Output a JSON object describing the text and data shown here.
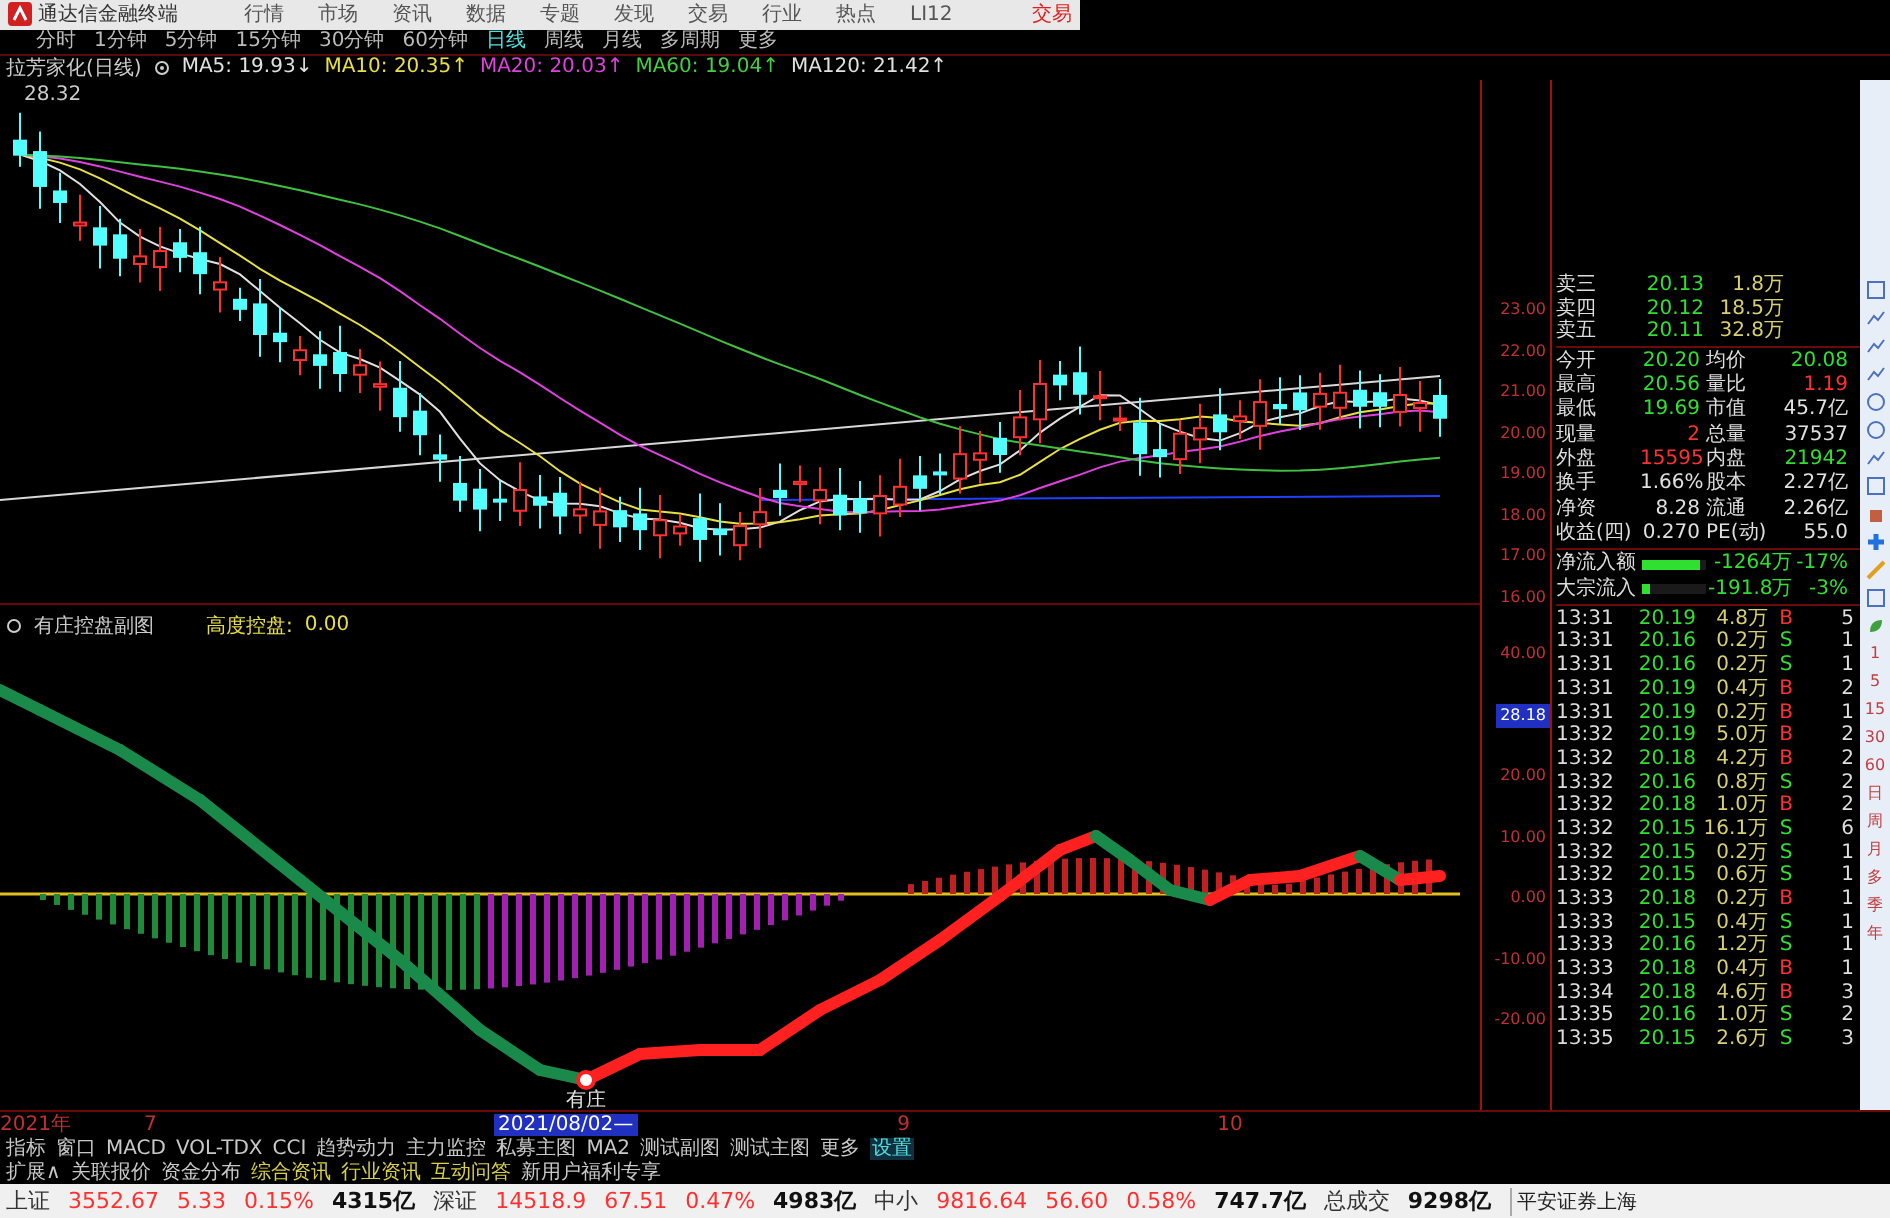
{
  "menu": {
    "app_title": "通达信金融终端",
    "items": [
      "行情",
      "市场",
      "资讯",
      "数据",
      "专题",
      "发现",
      "交易",
      "行业",
      "热点",
      "LI12"
    ],
    "trade_label": "交易"
  },
  "periods": [
    {
      "label": "分时",
      "selected": false
    },
    {
      "label": "1分钟",
      "selected": false
    },
    {
      "label": "5分钟",
      "selected": false
    },
    {
      "label": "15分钟",
      "selected": false
    },
    {
      "label": "30分钟",
      "selected": false
    },
    {
      "label": "60分钟",
      "selected": false
    },
    {
      "label": "日线",
      "selected": true
    },
    {
      "label": "周线",
      "selected": false
    },
    {
      "label": "月线",
      "selected": false
    },
    {
      "label": "多周期",
      "selected": false
    },
    {
      "label": "更多",
      "selected": false
    }
  ],
  "legend": {
    "stock": "拉芳家化(日线)",
    "items": [
      {
        "label": "MA5: 19.93↓",
        "color": "#e0e0e0"
      },
      {
        "label": "MA10: 20.35↑",
        "color": "#e8e040"
      },
      {
        "label": "MA20: 20.03↑",
        "color": "#e040e0"
      },
      {
        "label": "MA60: 19.04↑",
        "color": "#40d040"
      },
      {
        "label": "MA120: 21.42↑",
        "color": "#e0e0e0"
      }
    ]
  },
  "high_marker": "28.32",
  "price_axis": [
    "23.00",
    "22.00",
    "21.00",
    "20.00",
    "19.00",
    "18.00",
    "17.00",
    "16.00"
  ],
  "indicator": {
    "title": "有庄控盘副图",
    "reading_label": "高度控盘:",
    "reading_value": "0.00",
    "annotation": "有庄"
  },
  "indicator_axis": [
    {
      "label": "40.00",
      "highlighted": false
    },
    {
      "label": "28.18",
      "highlighted": true
    },
    {
      "label": "20.00",
      "highlighted": false
    },
    {
      "label": "10.00",
      "highlighted": false
    },
    {
      "label": "0.00",
      "highlighted": false
    },
    {
      "label": "-10.00",
      "highlighted": false
    },
    {
      "label": "-20.00",
      "highlighted": false
    }
  ],
  "order_book": [
    {
      "label": "卖三",
      "price": "20.13",
      "volume": "1.8万"
    },
    {
      "label": "卖四",
      "price": "20.12",
      "volume": "18.5万"
    },
    {
      "label": "卖五",
      "price": "20.11",
      "volume": "32.8万"
    }
  ],
  "stats": [
    {
      "cells": [
        {
          "label": "今开",
          "value": "20.20",
          "color": "#30e030"
        },
        {
          "label": "均价",
          "value": "20.08",
          "color": "#30e030"
        }
      ]
    },
    {
      "cells": [
        {
          "label": "最高",
          "value": "20.56",
          "color": "#30e030"
        },
        {
          "label": "量比",
          "value": "1.19",
          "color": "#ff3030"
        }
      ]
    },
    {
      "cells": [
        {
          "label": "最低",
          "value": "19.69",
          "color": "#30e030"
        },
        {
          "label": "市值",
          "value": "45.7亿",
          "color": "#e0e0e0"
        }
      ]
    },
    {
      "cells": [
        {
          "label": "现量",
          "value": "2",
          "color": "#ff3030"
        },
        {
          "label": "总量",
          "value": "37537",
          "color": "#e0e0e0"
        }
      ]
    },
    {
      "cells": [
        {
          "label": "外盘",
          "value": "15595",
          "color": "#ff3030"
        },
        {
          "label": "内盘",
          "value": "21942",
          "color": "#30e030"
        }
      ]
    },
    {
      "cells": [
        {
          "label": "换手",
          "value": "1.66%",
          "color": "#e0e0e0"
        },
        {
          "label": "股本",
          "value": "2.27亿",
          "color": "#e0e0e0"
        }
      ]
    },
    {
      "cells": [
        {
          "label": "净资",
          "value": "8.28",
          "color": "#e0e0e0"
        },
        {
          "label": "流通",
          "value": "2.26亿",
          "color": "#e0e0e0"
        }
      ]
    },
    {
      "cells": [
        {
          "label": "收益(四)",
          "value": "0.270",
          "color": "#e0e0e0"
        },
        {
          "label": "PE(动)",
          "value": "55.0",
          "color": "#e0e0e0"
        }
      ]
    }
  ],
  "flow": [
    {
      "label": "净流入额",
      "level": 0.9,
      "value": "-1264万",
      "pct": "-17%"
    },
    {
      "label": "大宗流入",
      "level": 0.12,
      "value": "-191.8万",
      "pct": "-3%"
    }
  ],
  "trades": [
    {
      "time": "13:31",
      "price": "20.19",
      "volume": "4.8万",
      "side": "B",
      "kind": "buy",
      "count": "5"
    },
    {
      "time": "13:31",
      "price": "20.16",
      "volume": "0.2万",
      "side": "S",
      "kind": "sell",
      "count": "1"
    },
    {
      "time": "13:31",
      "price": "20.16",
      "volume": "0.2万",
      "side": "S",
      "kind": "sell",
      "count": "1"
    },
    {
      "time": "13:31",
      "price": "20.19",
      "volume": "0.4万",
      "side": "B",
      "kind": "buy",
      "count": "2"
    },
    {
      "time": "13:31",
      "price": "20.19",
      "volume": "0.2万",
      "side": "B",
      "kind": "buy",
      "count": "1"
    },
    {
      "time": "13:32",
      "price": "20.19",
      "volume": "5.0万",
      "side": "B",
      "kind": "buy",
      "count": "2"
    },
    {
      "time": "13:32",
      "price": "20.18",
      "volume": "4.2万",
      "side": "B",
      "kind": "buy",
      "count": "2"
    },
    {
      "time": "13:32",
      "price": "20.16",
      "volume": "0.8万",
      "side": "S",
      "kind": "sell",
      "count": "2"
    },
    {
      "time": "13:32",
      "price": "20.18",
      "volume": "1.0万",
      "side": "B",
      "kind": "buy",
      "count": "2"
    },
    {
      "time": "13:32",
      "price": "20.15",
      "volume": "16.1万",
      "side": "S",
      "kind": "sell",
      "count": "6"
    },
    {
      "time": "13:32",
      "price": "20.15",
      "volume": "0.2万",
      "side": "S",
      "kind": "sell",
      "count": "1"
    },
    {
      "time": "13:32",
      "price": "20.15",
      "volume": "0.6万",
      "side": "S",
      "kind": "sell",
      "count": "1"
    },
    {
      "time": "13:33",
      "price": "20.18",
      "volume": "0.2万",
      "side": "B",
      "kind": "buy",
      "count": "1"
    },
    {
      "time": "13:33",
      "price": "20.15",
      "volume": "0.4万",
      "side": "S",
      "kind": "sell",
      "count": "1"
    },
    {
      "time": "13:33",
      "price": "20.16",
      "volume": "1.2万",
      "side": "S",
      "kind": "sell",
      "count": "1"
    },
    {
      "time": "13:33",
      "price": "20.18",
      "volume": "0.4万",
      "side": "B",
      "kind": "buy",
      "count": "1"
    },
    {
      "time": "13:34",
      "price": "20.18",
      "volume": "4.6万",
      "side": "B",
      "kind": "buy",
      "count": "3"
    },
    {
      "time": "13:35",
      "price": "20.16",
      "volume": "1.0万",
      "side": "S",
      "kind": "sell",
      "count": "2"
    },
    {
      "time": "13:35",
      "price": "20.15",
      "volume": "2.6万",
      "side": "S",
      "kind": "sell",
      "count": "3"
    }
  ],
  "side_periods": [
    "1",
    "5",
    "15",
    "30",
    "60",
    "日",
    "周",
    "月",
    "多",
    "季",
    "年"
  ],
  "time_axis": [
    {
      "label": "2021年",
      "selected": false
    },
    {
      "label": "7",
      "selected": false
    },
    {
      "label": "2021/08/02—",
      "selected": true
    },
    {
      "label": "9",
      "selected": false
    },
    {
      "label": "10",
      "selected": false
    }
  ],
  "indicator_tabs": [
    {
      "label": "指标",
      "selected": false
    },
    {
      "label": "窗口",
      "selected": false
    },
    {
      "label": "MACD",
      "selected": false
    },
    {
      "label": "VOL-TDX",
      "selected": false
    },
    {
      "label": "CCI",
      "selected": false
    },
    {
      "label": "趋势动力",
      "selected": false
    },
    {
      "label": "主力监控",
      "selected": false
    },
    {
      "label": "私募主图",
      "selected": false
    },
    {
      "label": "MA2",
      "selected": false
    },
    {
      "label": "测试副图",
      "selected": false
    },
    {
      "label": "测试主图",
      "selected": false
    },
    {
      "label": "更多",
      "selected": false
    },
    {
      "label": "设置",
      "selected": true
    }
  ],
  "ext_links": [
    {
      "label": "扩展∧",
      "color": "#c8c8c8"
    },
    {
      "label": "关联报价",
      "color": "#c8c8c8"
    },
    {
      "label": "资金分布",
      "color": "#c8c8c8"
    },
    {
      "label": "综合资讯",
      "color": "#d8d040"
    },
    {
      "label": "行业资讯",
      "color": "#d8d040"
    },
    {
      "label": "互动问答",
      "color": "#d8d040"
    },
    {
      "label": "新用户福利专享",
      "color": "#c8c8c8"
    }
  ],
  "status_bar": {
    "indices": [
      {
        "name": "上证",
        "value": "3552.67",
        "change": "5.33",
        "pct": "0.15%",
        "amount": "4315亿"
      },
      {
        "name": "深证",
        "value": "14518.9",
        "change": "67.51",
        "pct": "0.47%",
        "amount": "4983亿"
      },
      {
        "name": "中小",
        "value": "9816.64",
        "change": "56.60",
        "pct": "0.58%",
        "amount": "747.7亿"
      }
    ],
    "total_label": "总成交",
    "total_value": "9298亿",
    "ticker": "平安证券上海"
  }
}
